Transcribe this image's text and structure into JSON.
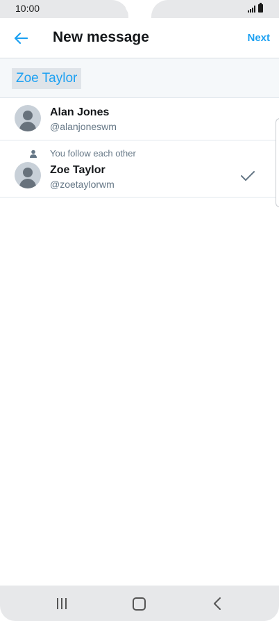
{
  "status_bar": {
    "time": "10:00",
    "signal_icon": "signal-icon",
    "battery_icon": "battery-icon"
  },
  "header": {
    "back_icon": "arrow-left-icon",
    "title": "New message",
    "next_label": "Next",
    "accent_color": "#1da1f2"
  },
  "search": {
    "chip_text": "Zoe Taylor"
  },
  "contacts": [
    {
      "name": "Alan Jones",
      "handle": "@alanjoneswm",
      "mutual_text": "",
      "selected": false
    },
    {
      "name": "Zoe Taylor",
      "handle": "@zoetaylorwm",
      "mutual_text": "You follow each other",
      "selected": true
    }
  ],
  "nav_bar": {
    "recents_icon": "recents-icon",
    "home_icon": "home-icon",
    "back_icon": "back-icon"
  }
}
